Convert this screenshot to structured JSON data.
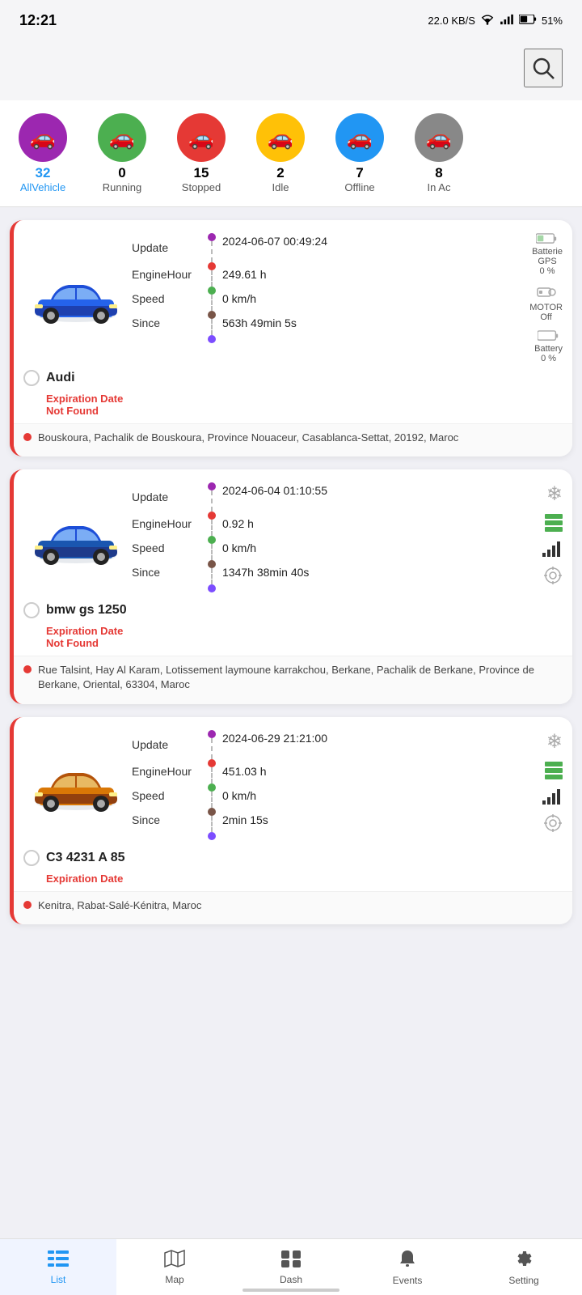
{
  "statusBar": {
    "time": "12:21",
    "networkSpeed": "22.0 KB/S",
    "battery": "51%"
  },
  "filterTabs": [
    {
      "id": "all",
      "count": "32",
      "label": "AllVehicle",
      "color": "#9c27b0",
      "active": true
    },
    {
      "id": "running",
      "count": "0",
      "label": "Running",
      "color": "#4caf50",
      "active": false
    },
    {
      "id": "stopped",
      "count": "15",
      "label": "Stopped",
      "color": "#e53935",
      "active": false
    },
    {
      "id": "idle",
      "count": "2",
      "label": "Idle",
      "color": "#ffc107",
      "active": false
    },
    {
      "id": "offline",
      "count": "7",
      "label": "Offline",
      "color": "#2196f3",
      "active": false
    },
    {
      "id": "inac",
      "count": "8",
      "label": "In Ac",
      "color": "#666",
      "active": false
    }
  ],
  "vehicles": [
    {
      "id": "audi",
      "name": "Audi",
      "carColor": "blue",
      "updateLabel": "Update",
      "updateValue": "2024-06-07 00:49:24",
      "engineLabel": "EngineHour",
      "engineValue": "249.61 h",
      "speedLabel": "Speed",
      "speedValue": "0 km/h",
      "sinceLabel": "Since",
      "sinceValue": "563h 49min 5s",
      "expiryLabel": "Expiration Date",
      "expiryValue": "Not Found",
      "batteryLabel": "Batterie",
      "batteryValue": "GPS",
      "batteryPct": "0 %",
      "motorLabel": "MOTOR",
      "motorValue": "Off",
      "battLabel": "Battery",
      "battPct": "0 %",
      "location": "Bouskoura, Pachalik de Bouskoura, Province Nouaceur, Casablanca-Settat, 20192, Maroc"
    },
    {
      "id": "bmw",
      "name": "bmw gs 1250",
      "carColor": "blue",
      "updateLabel": "Update",
      "updateValue": "2024-06-04 01:10:55",
      "engineLabel": "EngineHour",
      "engineValue": "0.92 h",
      "speedLabel": "Speed",
      "speedValue": "0 km/h",
      "sinceLabel": "Since",
      "sinceValue": "1347h 38min 40s",
      "expiryLabel": "Expiration Date",
      "expiryValue": "Not Found",
      "location": "Rue Talsint, Hay Al Karam, Lotissement laymoune karrakchou, Berkane, Pachalik de Berkane, Province de Berkane, Oriental, 63304, Maroc"
    },
    {
      "id": "c3",
      "name": "C3 4231 A 85",
      "carColor": "yellow",
      "updateLabel": "Update",
      "updateValue": "2024-06-29 21:21:00",
      "engineLabel": "EngineHour",
      "engineValue": "451.03 h",
      "speedLabel": "Speed",
      "speedValue": "0 km/h",
      "sinceLabel": "Since",
      "sinceValue": "2min 15s",
      "expiryLabel": "Expiration Date",
      "expiryValue": "",
      "location": "Kenitra, Rabat-Salé-Kénitra, Maroc"
    }
  ],
  "bottomNav": {
    "items": [
      {
        "id": "list",
        "label": "List",
        "active": true
      },
      {
        "id": "map",
        "label": "Map",
        "active": false
      },
      {
        "id": "dash",
        "label": "Dash",
        "active": false
      },
      {
        "id": "events",
        "label": "Events",
        "active": false
      },
      {
        "id": "setting",
        "label": "Setting",
        "active": false
      }
    ]
  }
}
